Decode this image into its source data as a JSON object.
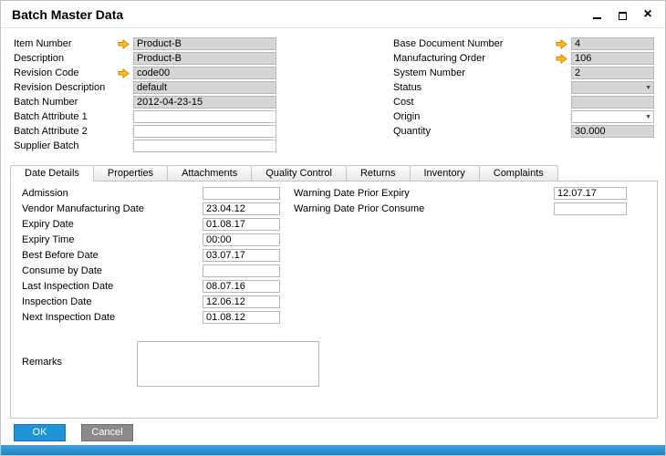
{
  "window": {
    "title": "Batch Master Data"
  },
  "icons": {
    "chevron_down": "▼",
    "close": "×",
    "minimize": "minimize-line",
    "maximize": "restore-square",
    "link_arrow": "orange-right-arrow"
  },
  "colors": {
    "accent_blue": "#1e93d6",
    "cancel_gray": "#8a8a8a",
    "readonly_bg": "#d6d6d6",
    "arrow_fill": "#ffc61a",
    "arrow_stroke": "#e07c00",
    "bottom_strip": "#1f85c7"
  },
  "header": {
    "left_fields": [
      {
        "label": "Item Number",
        "value": "Product-B",
        "readonly": true,
        "arrow": true,
        "dropdown": false
      },
      {
        "label": "Description",
        "value": "Product-B",
        "readonly": true,
        "arrow": false,
        "dropdown": false
      },
      {
        "label": "Revision Code",
        "value": "code00",
        "readonly": true,
        "arrow": true,
        "dropdown": false
      },
      {
        "label": "Revision Description",
        "value": "default",
        "readonly": true,
        "arrow": false,
        "dropdown": false
      },
      {
        "label": "Batch Number",
        "value": "2012-04-23-15",
        "readonly": true,
        "arrow": false,
        "dropdown": false
      },
      {
        "label": "Batch Attribute 1",
        "value": "",
        "readonly": false,
        "arrow": false,
        "dropdown": false
      },
      {
        "label": "Batch Attribute 2",
        "value": "",
        "readonly": false,
        "arrow": false,
        "dropdown": false
      },
      {
        "label": "Supplier Batch",
        "value": "",
        "readonly": false,
        "arrow": false,
        "dropdown": false
      }
    ],
    "right_fields": [
      {
        "label": "Base Document Number",
        "value": "4",
        "readonly": true,
        "arrow": true,
        "dropdown": false
      },
      {
        "label": "Manufacturing Order",
        "value": "106",
        "readonly": true,
        "arrow": true,
        "dropdown": false
      },
      {
        "label": "System Number",
        "value": "2",
        "readonly": true,
        "arrow": false,
        "dropdown": false
      },
      {
        "label": "Status",
        "value": "",
        "readonly": true,
        "arrow": false,
        "dropdown": true
      },
      {
        "label": "Cost",
        "value": "",
        "readonly": true,
        "arrow": false,
        "dropdown": false
      },
      {
        "label": "Origin",
        "value": "",
        "readonly": false,
        "arrow": false,
        "dropdown": true
      },
      {
        "label": "Quantity",
        "value": "30.000",
        "readonly": true,
        "arrow": false,
        "dropdown": false
      }
    ]
  },
  "tabs": {
    "items": [
      {
        "label": "Date Details",
        "active": true
      },
      {
        "label": "Properties",
        "active": false
      },
      {
        "label": "Attachments",
        "active": false
      },
      {
        "label": "Quality Control",
        "active": false
      },
      {
        "label": "Returns",
        "active": false
      },
      {
        "label": "Inventory",
        "active": false
      },
      {
        "label": "Complaints",
        "active": false
      }
    ]
  },
  "tab_content": {
    "left_fields": [
      {
        "label": "Admission",
        "value": "",
        "readonly": false,
        "arrow": false,
        "dropdown": false
      },
      {
        "label": "Vendor Manufacturing Date",
        "value": "23.04.12",
        "readonly": false,
        "arrow": false,
        "dropdown": false
      },
      {
        "label": "Expiry Date",
        "value": "01.08.17",
        "readonly": false,
        "arrow": false,
        "dropdown": false
      },
      {
        "label": "Expiry Time",
        "value": "00:00",
        "readonly": false,
        "arrow": false,
        "dropdown": false
      },
      {
        "label": "Best Before Date",
        "value": "03.07.17",
        "readonly": false,
        "arrow": false,
        "dropdown": false
      },
      {
        "label": "Consume by Date",
        "value": "",
        "readonly": false,
        "arrow": false,
        "dropdown": false
      },
      {
        "label": "Last Inspection Date",
        "value": "08.07.16",
        "readonly": false,
        "arrow": false,
        "dropdown": false
      },
      {
        "label": "Inspection Date",
        "value": "12.06.12",
        "readonly": false,
        "arrow": false,
        "dropdown": false
      },
      {
        "label": "Next Inspection Date",
        "value": "01.08.12",
        "readonly": false,
        "arrow": false,
        "dropdown": false
      }
    ],
    "right_fields": [
      {
        "label": "Warning Date Prior Expiry",
        "value": "12.07.17",
        "readonly": false,
        "arrow": false,
        "dropdown": false
      },
      {
        "label": "Warning Date Prior Consume",
        "value": "",
        "readonly": false,
        "arrow": false,
        "dropdown": false
      }
    ],
    "remarks_label": "Remarks",
    "remarks_value": ""
  },
  "footer": {
    "ok_label": "OK",
    "cancel_label": "Cancel"
  }
}
